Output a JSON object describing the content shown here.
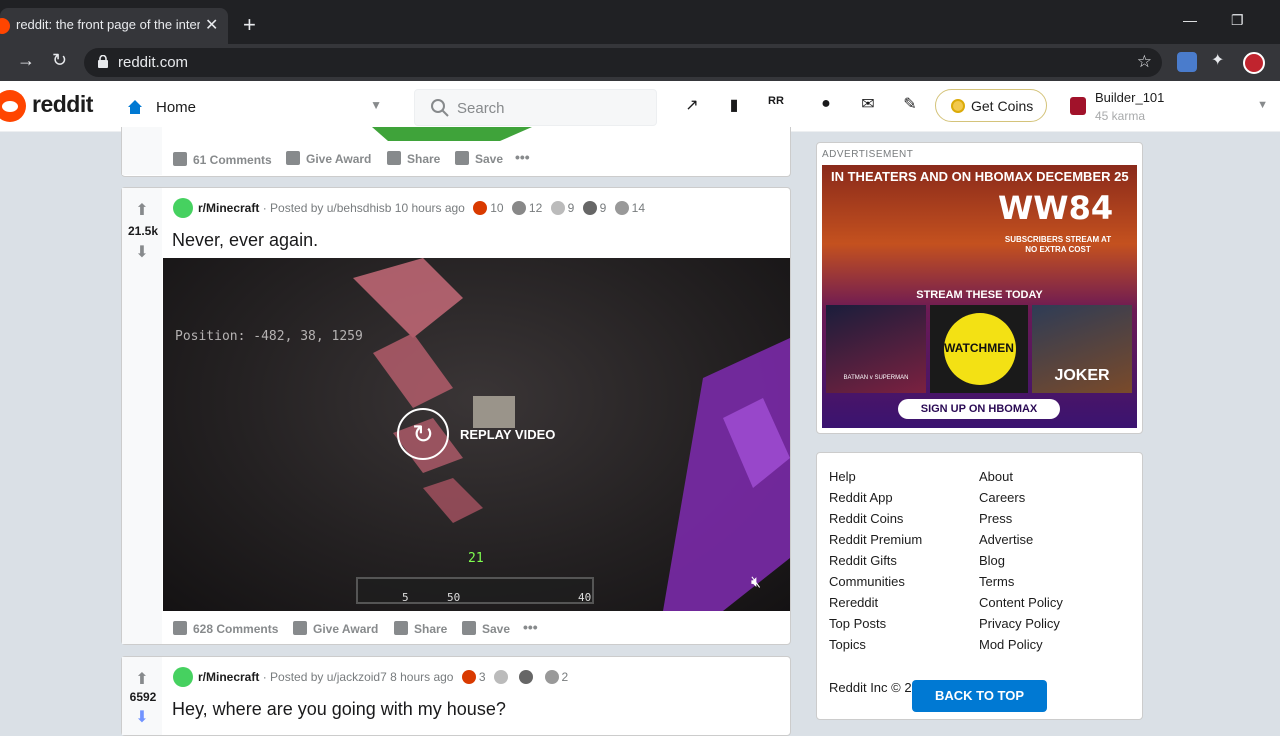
{
  "browser": {
    "tab_title": "reddit: the front page of the internet",
    "url": "reddit.com"
  },
  "header": {
    "logo": "reddit",
    "feed": "Home",
    "search_placeholder": "Search",
    "get_coins": "Get Coins",
    "username": "Builder_101",
    "karma": "45 karma"
  },
  "post0": {
    "comments": "61 Comments",
    "give_award": "Give Award",
    "share": "Share",
    "save": "Save"
  },
  "post1": {
    "score": "21.5k",
    "subreddit": "r/Minecraft",
    "posted_by": "· Posted by u/behsdhisb 10 hours ago",
    "awards": [
      "10",
      "12",
      "9",
      "9",
      "14"
    ],
    "title": "Never, ever again.",
    "video": {
      "coords": "Position: -482, 38, 1259",
      "replay": "REPLAY VIDEO",
      "level": "21",
      "hotbar_counts": [
        "5",
        "50",
        "40"
      ]
    },
    "comments": "628 Comments",
    "give_award": "Give Award",
    "share": "Share",
    "save": "Save"
  },
  "post2": {
    "score": "6592",
    "subreddit": "r/Minecraft",
    "posted_by": "· Posted by u/jackzoid7 8 hours ago",
    "awards": [
      "3",
      "2"
    ],
    "title": "Hey, where are you going with my house?"
  },
  "ad": {
    "label": "ADVERTISEMENT",
    "line1": "IN THEATERS AND ON HBOMAX DECEMBER 25",
    "headline": "WW84",
    "subtext": "SUBSCRIBERS STREAM AT NO EXTRA COST",
    "stream": "STREAM THESE TODAY",
    "poster2": "WATCHMEN",
    "poster3": "JOKER",
    "poster1": "BATMAN v SUPERMAN",
    "signup": "SIGN UP ON HBOMAX"
  },
  "footer": {
    "col1": [
      "Help",
      "Reddit App",
      "Reddit Coins",
      "Reddit Premium",
      "Reddit Gifts",
      "Communities",
      "Rereddit",
      "Top Posts",
      "Topics"
    ],
    "col2": [
      "About",
      "Careers",
      "Press",
      "Advertise",
      "Blog",
      "Terms",
      "Content Policy",
      "Privacy Policy",
      "Mod Policy"
    ],
    "copyright": "Reddit Inc © 2"
  },
  "back_to_top": "BACK TO TOP"
}
